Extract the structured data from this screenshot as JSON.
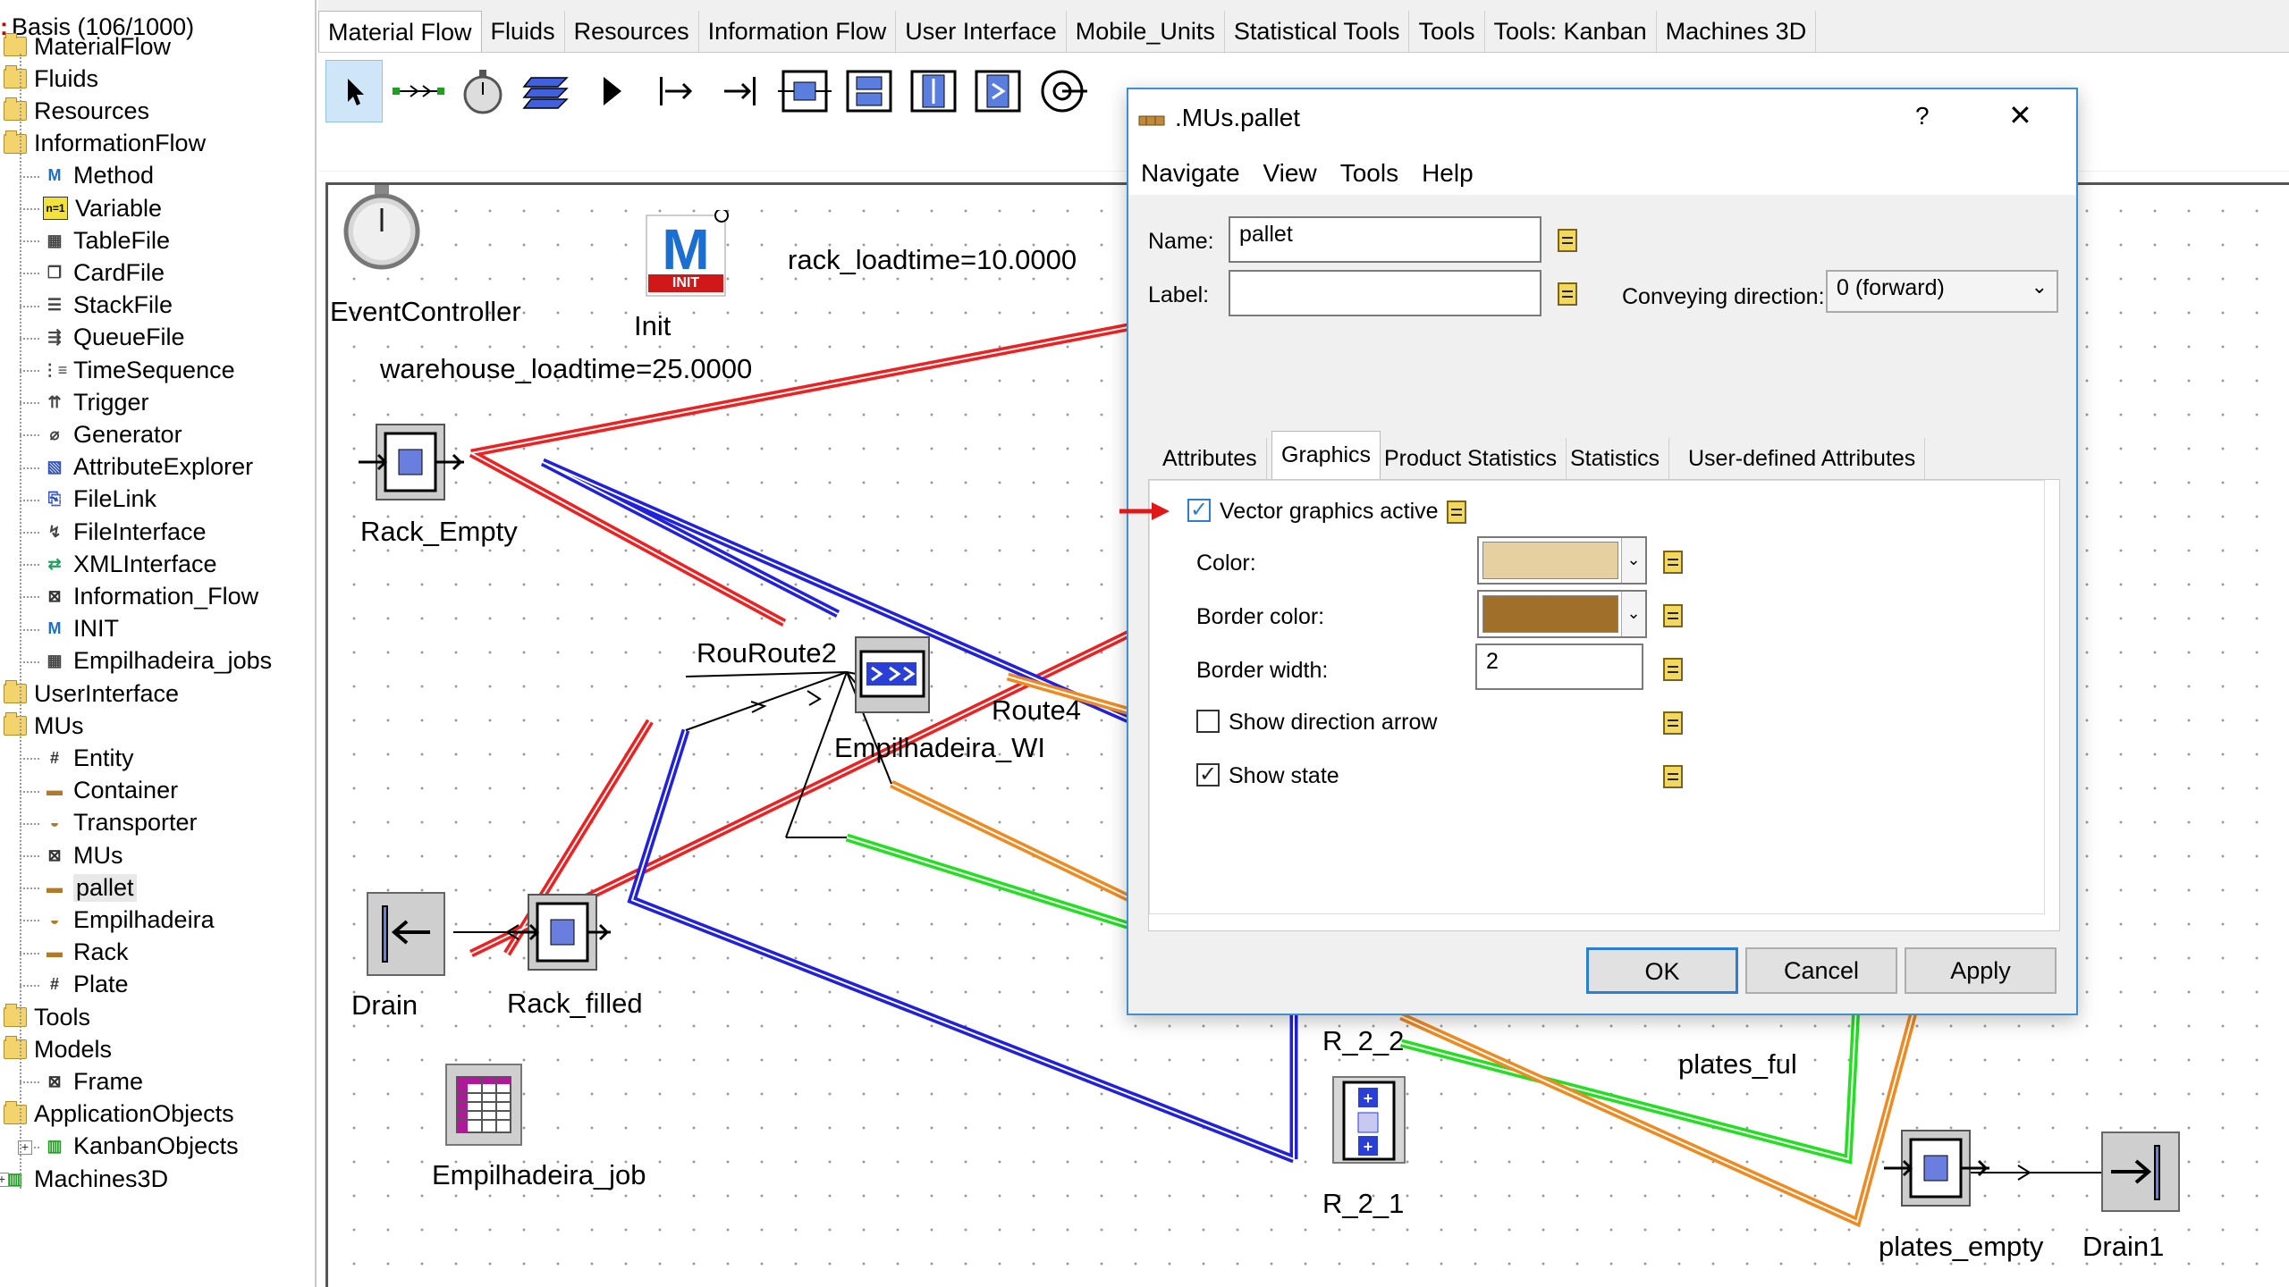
{
  "tree": {
    "root": "Basis (106/1000)",
    "items": [
      {
        "label": "MaterialFlow",
        "icon": "folder-icon",
        "level": 1
      },
      {
        "label": "Fluids",
        "icon": "folder-icon",
        "level": 1
      },
      {
        "label": "Resources",
        "icon": "folder-icon",
        "level": 1
      },
      {
        "label": "InformationFlow",
        "icon": "folder-icon",
        "level": 1
      },
      {
        "label": "Method",
        "icon": "method-icon",
        "level": 2
      },
      {
        "label": "Variable",
        "icon": "variable-icon",
        "level": 2
      },
      {
        "label": "TableFile",
        "icon": "table-icon",
        "level": 2
      },
      {
        "label": "CardFile",
        "icon": "cardfile-icon",
        "level": 2
      },
      {
        "label": "StackFile",
        "icon": "stackfile-icon",
        "level": 2
      },
      {
        "label": "QueueFile",
        "icon": "queuefile-icon",
        "level": 2
      },
      {
        "label": "TimeSequence",
        "icon": "timesequence-icon",
        "level": 2
      },
      {
        "label": "Trigger",
        "icon": "trigger-icon",
        "level": 2
      },
      {
        "label": "Generator",
        "icon": "generator-icon",
        "level": 2
      },
      {
        "label": "AttributeExplorer",
        "icon": "attribute-explorer-icon",
        "level": 2
      },
      {
        "label": "FileLink",
        "icon": "filelink-icon",
        "level": 2
      },
      {
        "label": "FileInterface",
        "icon": "fileinterface-icon",
        "level": 2
      },
      {
        "label": "XMLInterface",
        "icon": "xml-icon",
        "level": 2
      },
      {
        "label": "Information_Flow",
        "icon": "frame-icon",
        "level": 2
      },
      {
        "label": "INIT",
        "icon": "method-icon",
        "level": 2
      },
      {
        "label": "Empilhadeira_jobs",
        "icon": "table-icon",
        "level": 2
      },
      {
        "label": "UserInterface",
        "icon": "folder-icon",
        "level": 1
      },
      {
        "label": "MUs",
        "icon": "folder-icon",
        "level": 1
      },
      {
        "label": "Entity",
        "icon": "entity-icon",
        "level": 2
      },
      {
        "label": "Container",
        "icon": "container-icon",
        "level": 2
      },
      {
        "label": "Transporter",
        "icon": "transporter-icon",
        "level": 2
      },
      {
        "label": "MUs",
        "icon": "frame-icon",
        "level": 2
      },
      {
        "label": "pallet",
        "icon": "container-icon",
        "level": 2
      },
      {
        "label": "Empilhadeira",
        "icon": "transporter-icon",
        "level": 2
      },
      {
        "label": "Rack",
        "icon": "container-icon",
        "level": 2
      },
      {
        "label": "Plate",
        "icon": "entity-icon",
        "level": 2
      },
      {
        "label": "Tools",
        "icon": "folder-icon",
        "level": 1
      },
      {
        "label": "Models",
        "icon": "folder-icon",
        "level": 1
      },
      {
        "label": "Frame",
        "icon": "frame-icon",
        "level": 2
      },
      {
        "label": "ApplicationObjects",
        "icon": "folder-icon",
        "level": 1
      },
      {
        "label": "KanbanObjects",
        "icon": "library-icon",
        "level": 2
      },
      {
        "label": "Machines3D",
        "icon": "library-icon",
        "level": 1
      }
    ]
  },
  "tabs": [
    "Material Flow",
    "Fluids",
    "Resources",
    "Information Flow",
    "User Interface",
    "Mobile_Units",
    "Statistical Tools",
    "Tools",
    "Tools: Kanban",
    "Machines 3D"
  ],
  "canvas": {
    "labels": {
      "event_controller": "EventController",
      "init": "Init",
      "rack_loadtime": "rack_loadtime=10.0000",
      "warehouse_loadtime": "warehouse_loadtime=25.0000",
      "rack_empty": "Rack_Empty",
      "rou_route2": "RouRoute2",
      "route4": "Route4",
      "empilhadeira_wi": "Empilhadeira_WI",
      "drain": "Drain",
      "rack_filled": "Rack_filled",
      "empilhadeira_job": "Empilhadeira_job",
      "r_2_2": "R_2_2",
      "r_2_1": "R_2_1",
      "plates_full": "plates_ful",
      "plates_empty": "plates_empty",
      "drain1": "Drain1",
      "init_badge": "INIT"
    }
  },
  "dialog": {
    "title": ".MUs.pallet",
    "help": "?",
    "close": "✕",
    "menu": [
      "Navigate",
      "View",
      "Tools",
      "Help"
    ],
    "name_label": "Name:",
    "name_value": "pallet",
    "label_label": "Label:",
    "label_value": "",
    "conveying_label": "Conveying direction:",
    "conveying_value": "0 (forward)",
    "tabs": [
      "Attributes",
      "Graphics",
      "Product Statistics",
      "Statistics",
      "User-defined Attributes"
    ],
    "active_tab": "Graphics",
    "vector_graphics_label": "Vector graphics active",
    "vector_graphics_checked": true,
    "color_label": "Color:",
    "color_value": "#e6cfa0",
    "border_color_label": "Border color:",
    "border_color_value": "#a0702a",
    "border_width_label": "Border width:",
    "border_width_value": "2",
    "show_direction_label": "Show direction arrow",
    "show_direction_checked": false,
    "show_state_label": "Show state",
    "show_state_checked": true,
    "ok": "OK",
    "cancel": "Cancel",
    "apply": "Apply"
  },
  "colors": {
    "accent": "#2a7fd4",
    "red_route": "#f02020",
    "blue_route": "#2020e0",
    "green_route": "#20e020",
    "orange_route": "#f08a20"
  }
}
